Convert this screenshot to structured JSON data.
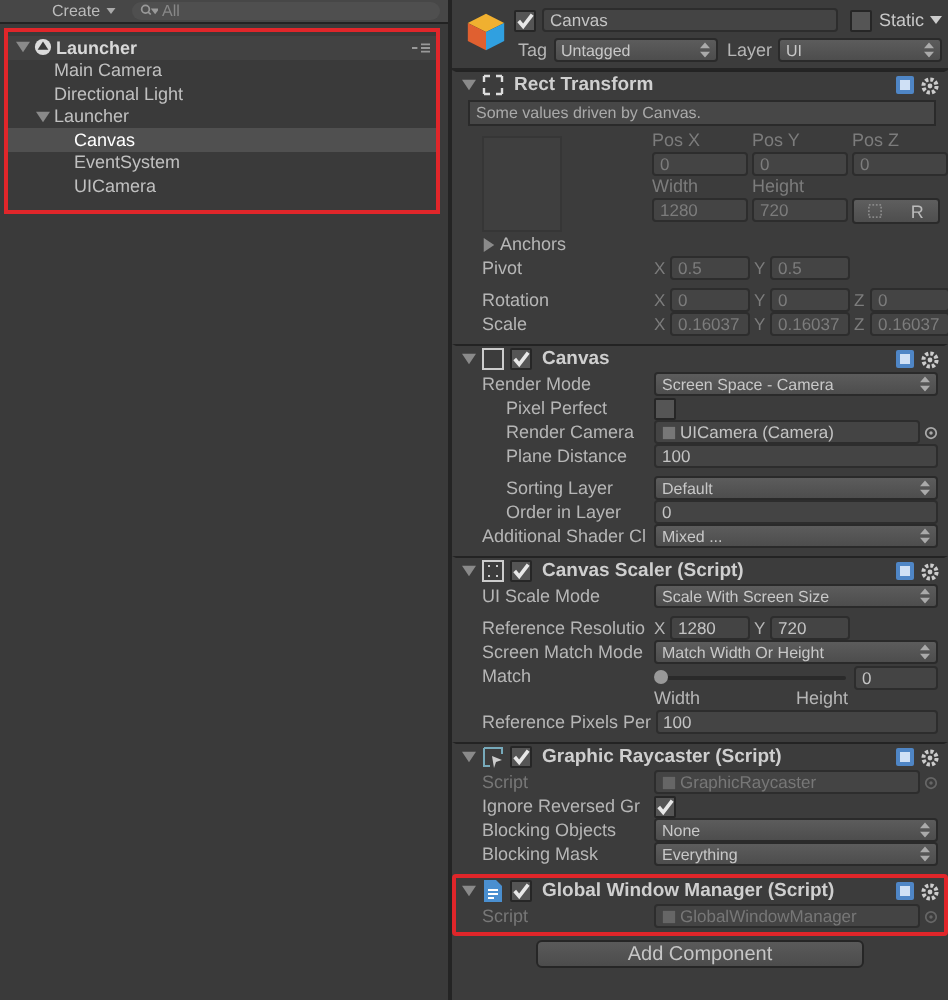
{
  "hierarchy": {
    "create_button": "Create",
    "search": {
      "placeholder": "All"
    },
    "highlighted": true,
    "tree": [
      {
        "label": "Launcher",
        "kind": "scene",
        "expanded": true,
        "selected": false,
        "children": [
          {
            "label": "Main Camera",
            "selected": false
          },
          {
            "label": "Directional Light",
            "selected": false
          },
          {
            "label": "Launcher",
            "expanded": true,
            "selected": false,
            "children": [
              {
                "label": "Canvas",
                "selected": true
              },
              {
                "label": "EventSystem",
                "selected": false
              },
              {
                "label": "UICamera",
                "selected": false
              }
            ]
          }
        ]
      }
    ]
  },
  "inspector": {
    "object": {
      "active": true,
      "name": "Canvas",
      "static_label": "Static",
      "static": false,
      "tag_label": "Tag",
      "tag": "Untagged",
      "layer_label": "Layer",
      "layer": "UI"
    },
    "components": [
      {
        "kind": "transform",
        "title": "Rect Transform",
        "expanded": true,
        "highlighted": false,
        "driven": true,
        "note": "Some values driven by Canvas.",
        "grid": [
          [
            {
              "label": "Pos X",
              "value": "0"
            },
            {
              "label": "Pos Y",
              "value": "0"
            },
            {
              "label": "Pos Z",
              "value": "0"
            }
          ],
          [
            {
              "label": "Width",
              "value": "1280"
            },
            {
              "label": "Height",
              "value": "720"
            }
          ]
        ],
        "reset_button": "R",
        "rows": [
          {
            "kind": "foldout",
            "label": "Anchors",
            "expanded": false
          },
          {
            "kind": "vector",
            "label": "Pivot",
            "fields": [
              {
                "axis": "X",
                "value": "0.5"
              },
              {
                "axis": "Y",
                "value": "0.5"
              }
            ]
          },
          {
            "kind": "vector",
            "label": "Rotation",
            "gap": true,
            "fields": [
              {
                "axis": "X",
                "value": "0"
              },
              {
                "axis": "Y",
                "value": "0"
              },
              {
                "axis": "Z",
                "value": "0"
              }
            ]
          },
          {
            "kind": "vector",
            "label": "Scale",
            "fields": [
              {
                "axis": "X",
                "value": "0.16037"
              },
              {
                "axis": "Y",
                "value": "0.16037"
              },
              {
                "axis": "Z",
                "value": "0.16037"
              }
            ]
          }
        ]
      },
      {
        "kind": "canvas",
        "title": "Canvas",
        "expanded": true,
        "enabled": true,
        "highlighted": false,
        "rows": [
          {
            "kind": "dropdown",
            "label": "Render Mode",
            "value": "Screen Space - Camera"
          },
          {
            "kind": "checkbox",
            "label": "Pixel Perfect",
            "indent": true,
            "checked": false
          },
          {
            "kind": "object",
            "label": "Render Camera",
            "indent": true,
            "value": "UICamera (Camera)"
          },
          {
            "kind": "field",
            "label": "Plane Distance",
            "indent": true,
            "value": "100"
          },
          {
            "kind": "dropdown",
            "label": "Sorting Layer",
            "indent": true,
            "gap": true,
            "value": "Default"
          },
          {
            "kind": "field",
            "label": "Order in Layer",
            "indent": true,
            "value": "0"
          },
          {
            "kind": "dropdown",
            "label": "Additional Shader Cl",
            "value": "Mixed ..."
          }
        ]
      },
      {
        "kind": "scaler",
        "title": "Canvas Scaler (Script)",
        "expanded": true,
        "enabled": true,
        "highlighted": false,
        "rows": [
          {
            "kind": "dropdown",
            "label": "UI Scale Mode",
            "value": "Scale With Screen Size"
          },
          {
            "kind": "vector",
            "label": "Reference Resolutio",
            "gap": true,
            "fields": [
              {
                "axis": "X",
                "value": "1280"
              },
              {
                "axis": "Y",
                "value": "720"
              }
            ]
          },
          {
            "kind": "dropdown",
            "label": "Screen Match Mode",
            "value": "Match Width Or Height"
          },
          {
            "kind": "slider",
            "label": "Match",
            "level": 0,
            "value": "0",
            "min_label": "Width",
            "max_label": "Height"
          },
          {
            "kind": "field",
            "label": "Reference Pixels Per",
            "value": "100"
          }
        ]
      },
      {
        "kind": "raycaster",
        "title": "Graphic Raycaster (Script)",
        "expanded": true,
        "enabled": true,
        "highlighted": false,
        "rows": [
          {
            "kind": "object",
            "label": "Script",
            "disabled": true,
            "value": "GraphicRaycaster"
          },
          {
            "kind": "checkbox",
            "label": "Ignore Reversed Gr",
            "checked": true
          },
          {
            "kind": "dropdown",
            "label": "Blocking Objects",
            "value": "None"
          },
          {
            "kind": "dropdown",
            "label": "Blocking Mask",
            "value": "Everything"
          }
        ]
      },
      {
        "kind": "script",
        "title": "Global Window Manager (Script)",
        "expanded": true,
        "enabled": true,
        "highlighted": true,
        "rows": [
          {
            "kind": "object",
            "label": "Script",
            "disabled": true,
            "value": "GlobalWindowManager"
          }
        ]
      }
    ],
    "add_button": "Add Component"
  }
}
